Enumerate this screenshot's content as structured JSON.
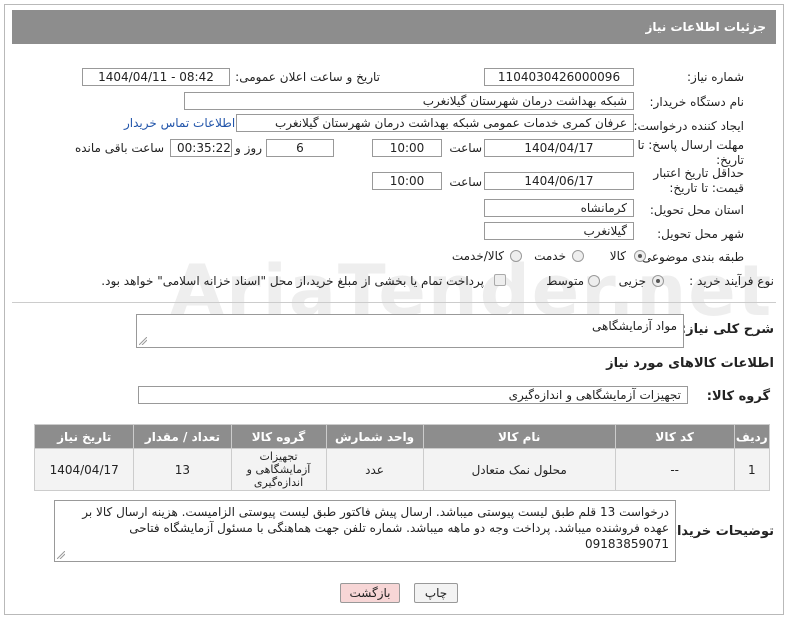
{
  "header": {
    "title": "جزئیات اطلاعات نیاز"
  },
  "need_number": {
    "label": "شماره نیاز:",
    "value": "1104030426000096"
  },
  "announce": {
    "label": "تاریخ و ساعت اعلان عمومی:",
    "value": "1404/04/11 - 08:42"
  },
  "buyer": {
    "label": "نام دستگاه خریدار:",
    "value": "شبکه بهداشت درمان شهرستان گیلانغرب"
  },
  "creator": {
    "label": "ایجاد کننده درخواست:",
    "value": "عرفان کمری خدمات عمومی شبکه بهداشت درمان شهرستان گیلانغرب",
    "contact_link": "اطلاعات تماس خریدار"
  },
  "reply_deadline": {
    "label": "مهلت ارسال پاسخ: تا تاریخ:",
    "date": "1404/04/17",
    "time_label": "ساعت",
    "time": "10:00",
    "days": "6",
    "days_label": "روز و",
    "remaining": "00:35:22",
    "remaining_label": "ساعت باقی مانده"
  },
  "price_validity": {
    "label": "حداقل تاریخ اعتبار قیمت: تا تاریخ:",
    "date": "1404/06/17",
    "time_label": "ساعت",
    "time": "10:00"
  },
  "province": {
    "label": "استان محل تحویل:",
    "value": "کرمانشاه"
  },
  "city": {
    "label": "شهر محل تحویل:",
    "value": "گیلانغرب"
  },
  "category": {
    "label": "طبقه بندی موضوعی:",
    "options": [
      "کالا",
      "خدمت",
      "کالا/خدمت"
    ],
    "selected": "کالا"
  },
  "process": {
    "label": "نوع فرآیند خرید :",
    "options": [
      "جزیی",
      "متوسط"
    ],
    "selected": "جزیی",
    "payment_note": "پرداخت تمام یا بخشی از مبلغ خرید،از محل \"اسناد خزانه اسلامی\" خواهد بود."
  },
  "description": {
    "label": "شرح کلی نیاز:",
    "value": "مواد آزمایشگاهی"
  },
  "goods_info": {
    "title": "اطلاعات کالاهای مورد نیاز"
  },
  "goods_group": {
    "label": "گروه کالا:",
    "value": "تجهیزات آزمایشگاهی و اندازه‌گیری"
  },
  "table": {
    "headers": [
      "ردیف",
      "کد کالا",
      "نام کالا",
      "واحد شمارش",
      "گروه کالا",
      "تعداد / مقدار",
      "تاریخ نیاز"
    ],
    "rows": [
      {
        "row": "1",
        "code": "--",
        "name": "محلول نمک متعادل",
        "unit": "عدد",
        "group": "تجهیزات آزمایشگاهی و اندازه‌گیری",
        "qty": "13",
        "date": "1404/04/17"
      }
    ]
  },
  "buyer_notes": {
    "label": "توضیحات خریدار:",
    "value": "درخواست 13 قلم طبق لیست پیوستی میباشد. ارسال پیش فاکتور طبق لیست پیوستی الزامیست. هزینه ارسال کالا بر عهده فروشنده میباشد. پرداخت وجه دو ماهه میباشد. شماره تلفن جهت هماهنگی با مسئول آزمایشگاه  فتاحی 09183859071"
  },
  "buttons": {
    "print": "چاپ",
    "back": "بازگشت"
  },
  "colors": {
    "header_bg": "#8d8d8d",
    "link": "#2255aa",
    "back_button": "#f7d6d6"
  }
}
